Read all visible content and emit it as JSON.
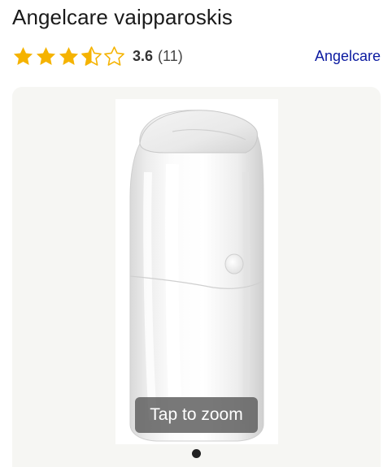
{
  "product": {
    "title": "Angelcare vaipparoskis",
    "brand": "Angelcare"
  },
  "rating": {
    "value": "3.6",
    "count": "(11)",
    "stars": 3.5,
    "max_stars": 5,
    "star_color": "#f5b301"
  },
  "gallery": {
    "zoom_label": "Tap to zoom",
    "image_icon": "diaper-pail-image",
    "pagination": {
      "current": 1,
      "total": 1
    }
  },
  "colors": {
    "brand_link": "#0b1aa0",
    "gallery_background": "#f6f6f3"
  }
}
